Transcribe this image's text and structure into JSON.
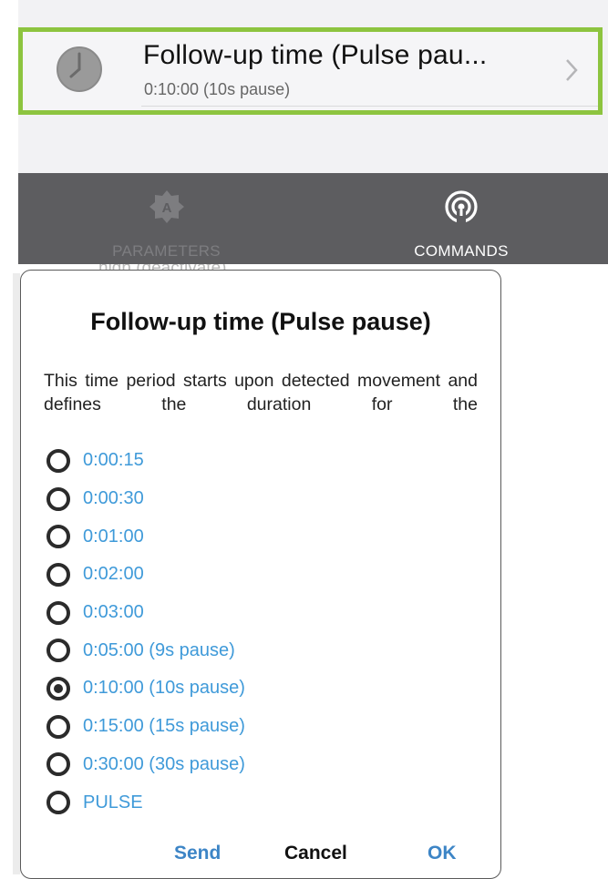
{
  "setting": {
    "title": "Follow-up time (Pulse pau...",
    "value": "0:10:00 (10s pause)",
    "icon": "clock-icon",
    "chevron": "chevron-right-icon",
    "highlight_color": "#8dc43f"
  },
  "tabs": [
    {
      "label": "PARAMETERS",
      "icon": "parameters-badge-icon",
      "active": false
    },
    {
      "label": "COMMANDS",
      "icon": "broadcast-icon",
      "active": true
    }
  ],
  "background_peek": "high (deactivate)",
  "dialog": {
    "title": "Follow-up time (Pulse pause)",
    "message": "This time period starts upon detected movement and defines the duration for the",
    "options": [
      {
        "label": "0:00:15",
        "selected": false
      },
      {
        "label": "0:00:30",
        "selected": false
      },
      {
        "label": "0:01:00",
        "selected": false
      },
      {
        "label": "0:02:00",
        "selected": false
      },
      {
        "label": "0:03:00",
        "selected": false
      },
      {
        "label": "0:05:00 (9s pause)",
        "selected": false
      },
      {
        "label": "0:10:00 (10s pause)",
        "selected": true
      },
      {
        "label": "0:15:00 (15s pause)",
        "selected": false
      },
      {
        "label": "0:30:00 (30s pause)",
        "selected": false
      },
      {
        "label": "PULSE",
        "selected": false
      }
    ],
    "buttons": {
      "send": "Send",
      "cancel": "Cancel",
      "ok": "OK"
    }
  },
  "colors": {
    "tabbar": "#5d5d60",
    "option_text": "#3f9ad9",
    "button_accent": "#3d85c6"
  }
}
